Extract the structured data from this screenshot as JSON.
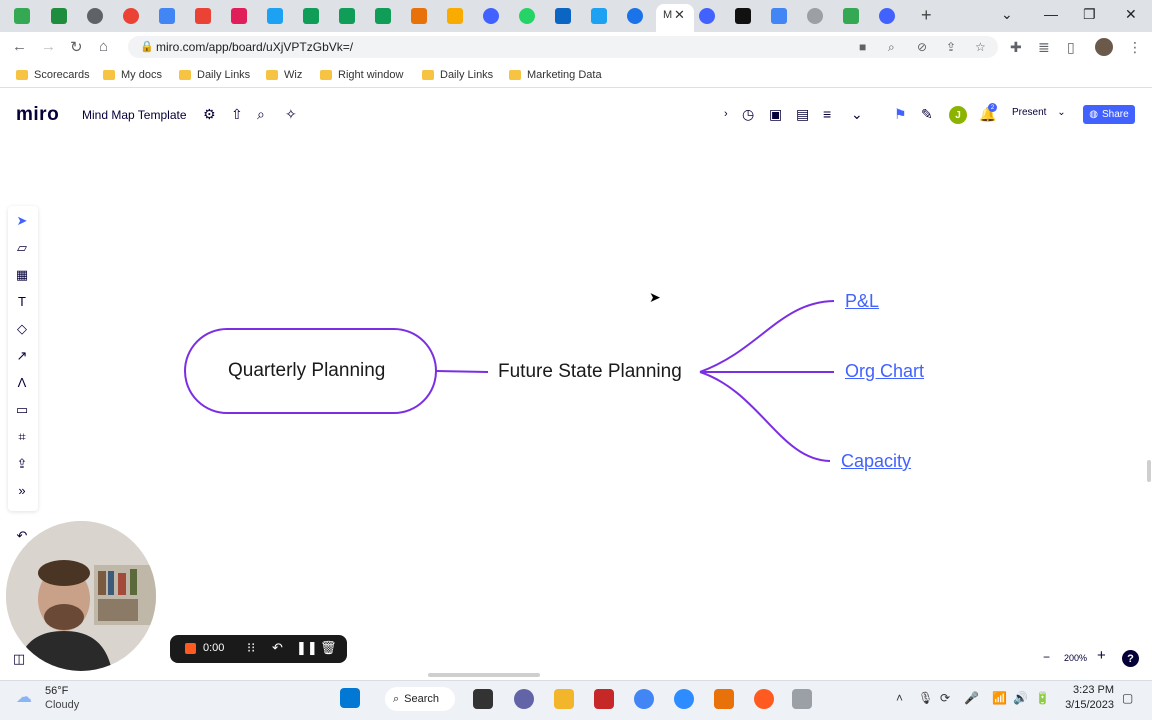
{
  "browser": {
    "active_tab_label": "M",
    "url": "miro.com/app/board/uXjVPTzGbVk=/",
    "bookmarks": [
      "Scorecards",
      "My docs",
      "Daily Links",
      "Wiz",
      "Right window",
      "Daily Links",
      "Marketing Data"
    ]
  },
  "miro": {
    "logo": "miro",
    "board_name": "Mind Map Template",
    "present_label": "Present",
    "share_label": "Share",
    "avatar_initial": "J",
    "notification_count": "2"
  },
  "mindmap": {
    "root": "Quarterly Planning",
    "center": "Future State Planning",
    "branches": [
      "P&L",
      "Org Chart",
      "Capacity"
    ],
    "line_color": "#7b2fe3"
  },
  "recorder": {
    "time": "0:00"
  },
  "zoom": {
    "level": "200%",
    "help": "?"
  },
  "taskbar": {
    "temperature": "56°F",
    "condition": "Cloudy",
    "search_label": "Search",
    "time": "3:23 PM",
    "date": "3/15/2023"
  },
  "colors": {
    "accent": "#4262ff",
    "miro_dark": "#050038",
    "rec_orange": "#ff5a1f"
  }
}
